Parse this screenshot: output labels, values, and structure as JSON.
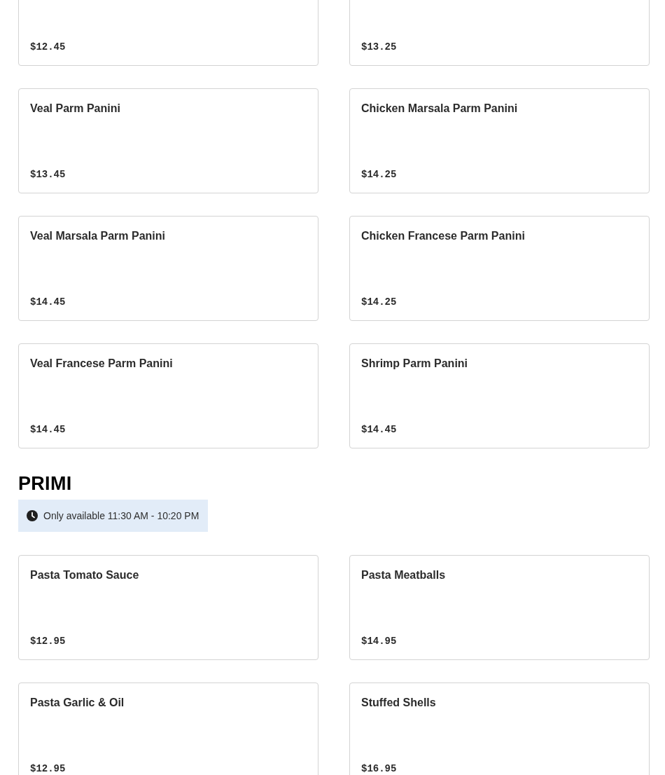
{
  "sections": [
    {
      "items": [
        {
          "price": "$12.45"
        },
        {
          "price": "$13.25"
        },
        {
          "name": "Veal Parm Panini",
          "price": "$13.45"
        },
        {
          "name": "Chicken Marsala Parm Panini",
          "price": "$14.25"
        },
        {
          "name": "Veal Marsala Parm Panini",
          "price": "$14.45"
        },
        {
          "name": "Chicken Francese Parm Panini",
          "price": "$14.25"
        },
        {
          "name": "Veal Francese Parm Panini",
          "price": "$14.45"
        },
        {
          "name": "Shrimp Parm Panini",
          "price": "$14.45"
        }
      ]
    },
    {
      "title": "PRIMI",
      "availability": "Only available 11:30 AM - 10:20 PM",
      "items": [
        {
          "name": "Pasta Tomato Sauce",
          "price": "$12.95"
        },
        {
          "name": "Pasta Meatballs",
          "price": "$14.95"
        },
        {
          "name": "Pasta Garlic & Oil",
          "price": "$12.95"
        },
        {
          "name": "Stuffed Shells",
          "price": "$16.95"
        }
      ]
    }
  ]
}
